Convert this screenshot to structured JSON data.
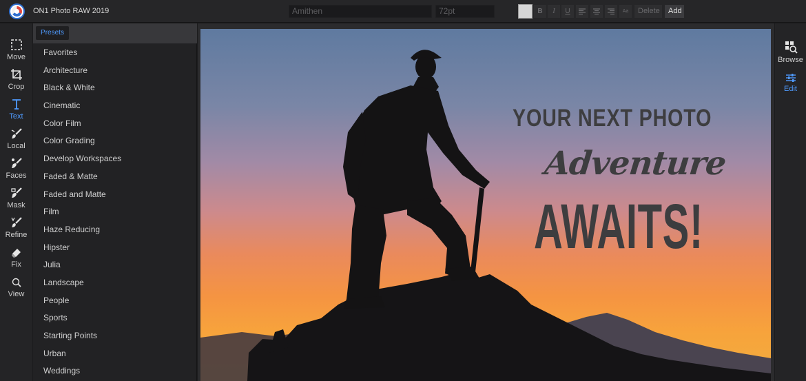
{
  "app": {
    "title": "ON1 Photo RAW 2019"
  },
  "text_toolbar": {
    "font_value": "Amithen",
    "size_value": "72pt",
    "bold_label": "B",
    "italic_label": "I",
    "underline_label": "U",
    "small_caps_label": "Aa",
    "delete_label": "Delete",
    "add_label": "Add",
    "swatch_color": "#d6d6d6"
  },
  "tools": [
    {
      "label": "Move",
      "icon": "move-icon"
    },
    {
      "label": "Crop",
      "icon": "crop-icon"
    },
    {
      "label": "Text",
      "icon": "text-icon",
      "active": true
    },
    {
      "label": "Local",
      "icon": "local-brush-icon"
    },
    {
      "label": "Faces",
      "icon": "faces-icon"
    },
    {
      "label": "Mask",
      "icon": "mask-icon"
    },
    {
      "label": "Refine",
      "icon": "refine-icon"
    },
    {
      "label": "Fix",
      "icon": "fix-icon"
    },
    {
      "label": "View",
      "icon": "magnifier-icon"
    }
  ],
  "presets": {
    "tab_label": "Presets",
    "items": [
      "Favorites",
      "Architecture",
      "Black & White",
      "Cinematic",
      "Color Film",
      "Color Grading",
      "Develop Workspaces",
      "Faded & Matte",
      "Faded and Matte",
      "Film",
      "Haze Reducing",
      "Hipster",
      "Julia",
      "Landscape",
      "People",
      "Sports",
      "Starting Points",
      "Urban",
      "Weddings"
    ]
  },
  "photo_text": {
    "line1": "YOUR  NEXT PHOTO",
    "line2": "Adventure",
    "line3": "AWAITS!"
  },
  "right_rail": [
    {
      "label": "Browse",
      "icon": "browse-icon"
    },
    {
      "label": "Edit",
      "icon": "sliders-icon",
      "active": true
    }
  ],
  "colors": {
    "accent": "#4f9bff",
    "text_overlay": "#3d3d3f"
  }
}
